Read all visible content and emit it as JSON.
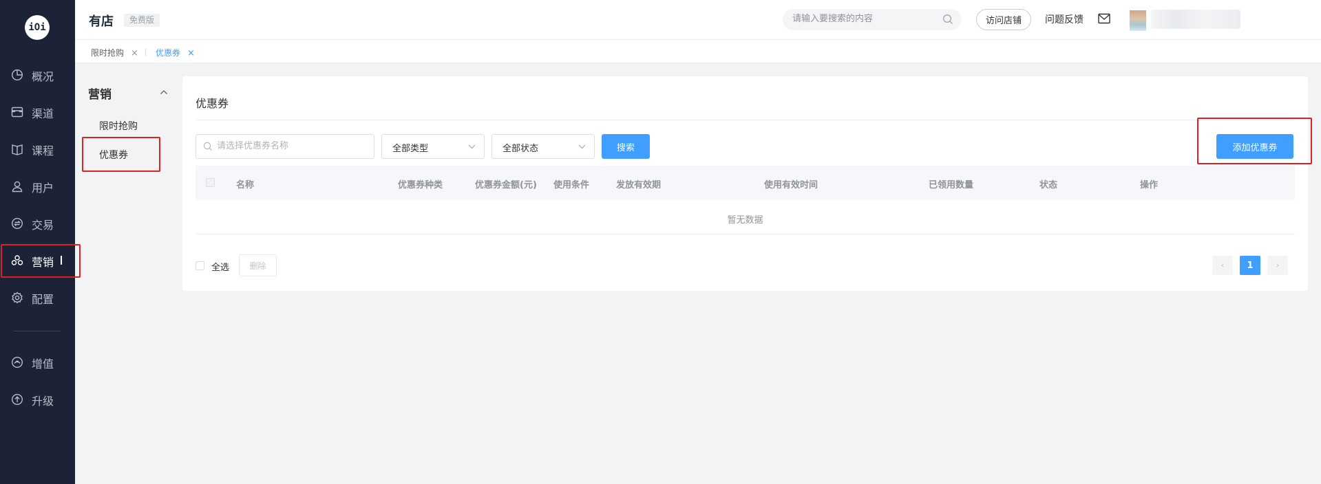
{
  "app": {
    "logo_text": "iOi",
    "brand": "有店",
    "edition": "免费版"
  },
  "header": {
    "search_placeholder": "请输入要搜索的内容",
    "visit_store": "访问店铺",
    "feedback": "问题反馈"
  },
  "sidebar": {
    "items": [
      {
        "label": "概况",
        "icon": "pie-chart-icon"
      },
      {
        "label": "渠道",
        "icon": "storefront-icon"
      },
      {
        "label": "课程",
        "icon": "book-icon"
      },
      {
        "label": "用户",
        "icon": "user-icon"
      },
      {
        "label": "交易",
        "icon": "exchange-icon"
      },
      {
        "label": "营销",
        "icon": "marketing-icon",
        "active": true
      },
      {
        "label": "配置",
        "icon": "gear-icon"
      },
      {
        "label": "增值",
        "icon": "value-added-icon"
      },
      {
        "label": "升级",
        "icon": "upgrade-icon"
      }
    ]
  },
  "tabs": [
    {
      "label": "限时抢购",
      "close": "×",
      "active": false
    },
    {
      "label": "优惠券",
      "close": "×",
      "active": true
    }
  ],
  "submenu": {
    "title": "营销",
    "items": [
      {
        "label": "限时抢购"
      },
      {
        "label": "优惠券",
        "active": true
      }
    ]
  },
  "main": {
    "title": "优惠券",
    "filters": {
      "name_placeholder": "请选择优惠券名称",
      "type_value": "全部类型",
      "status_value": "全部状态",
      "search_button": "搜索"
    },
    "add_button": "添加优惠券",
    "table": {
      "columns": [
        "名称",
        "优惠券种类",
        "优惠券金额(元)",
        "使用条件",
        "发放有效期",
        "使用有效时间",
        "已领用数量",
        "状态",
        "操作"
      ],
      "empty_text": "暂无数据"
    },
    "footer": {
      "select_all": "全选",
      "delete_button": "删除"
    },
    "pagination": {
      "prev": "‹",
      "current": "1",
      "next": "›"
    }
  },
  "colors": {
    "sidebar_bg": "#1c2336",
    "primary": "#409eff",
    "highlight_box": "#e02020"
  }
}
